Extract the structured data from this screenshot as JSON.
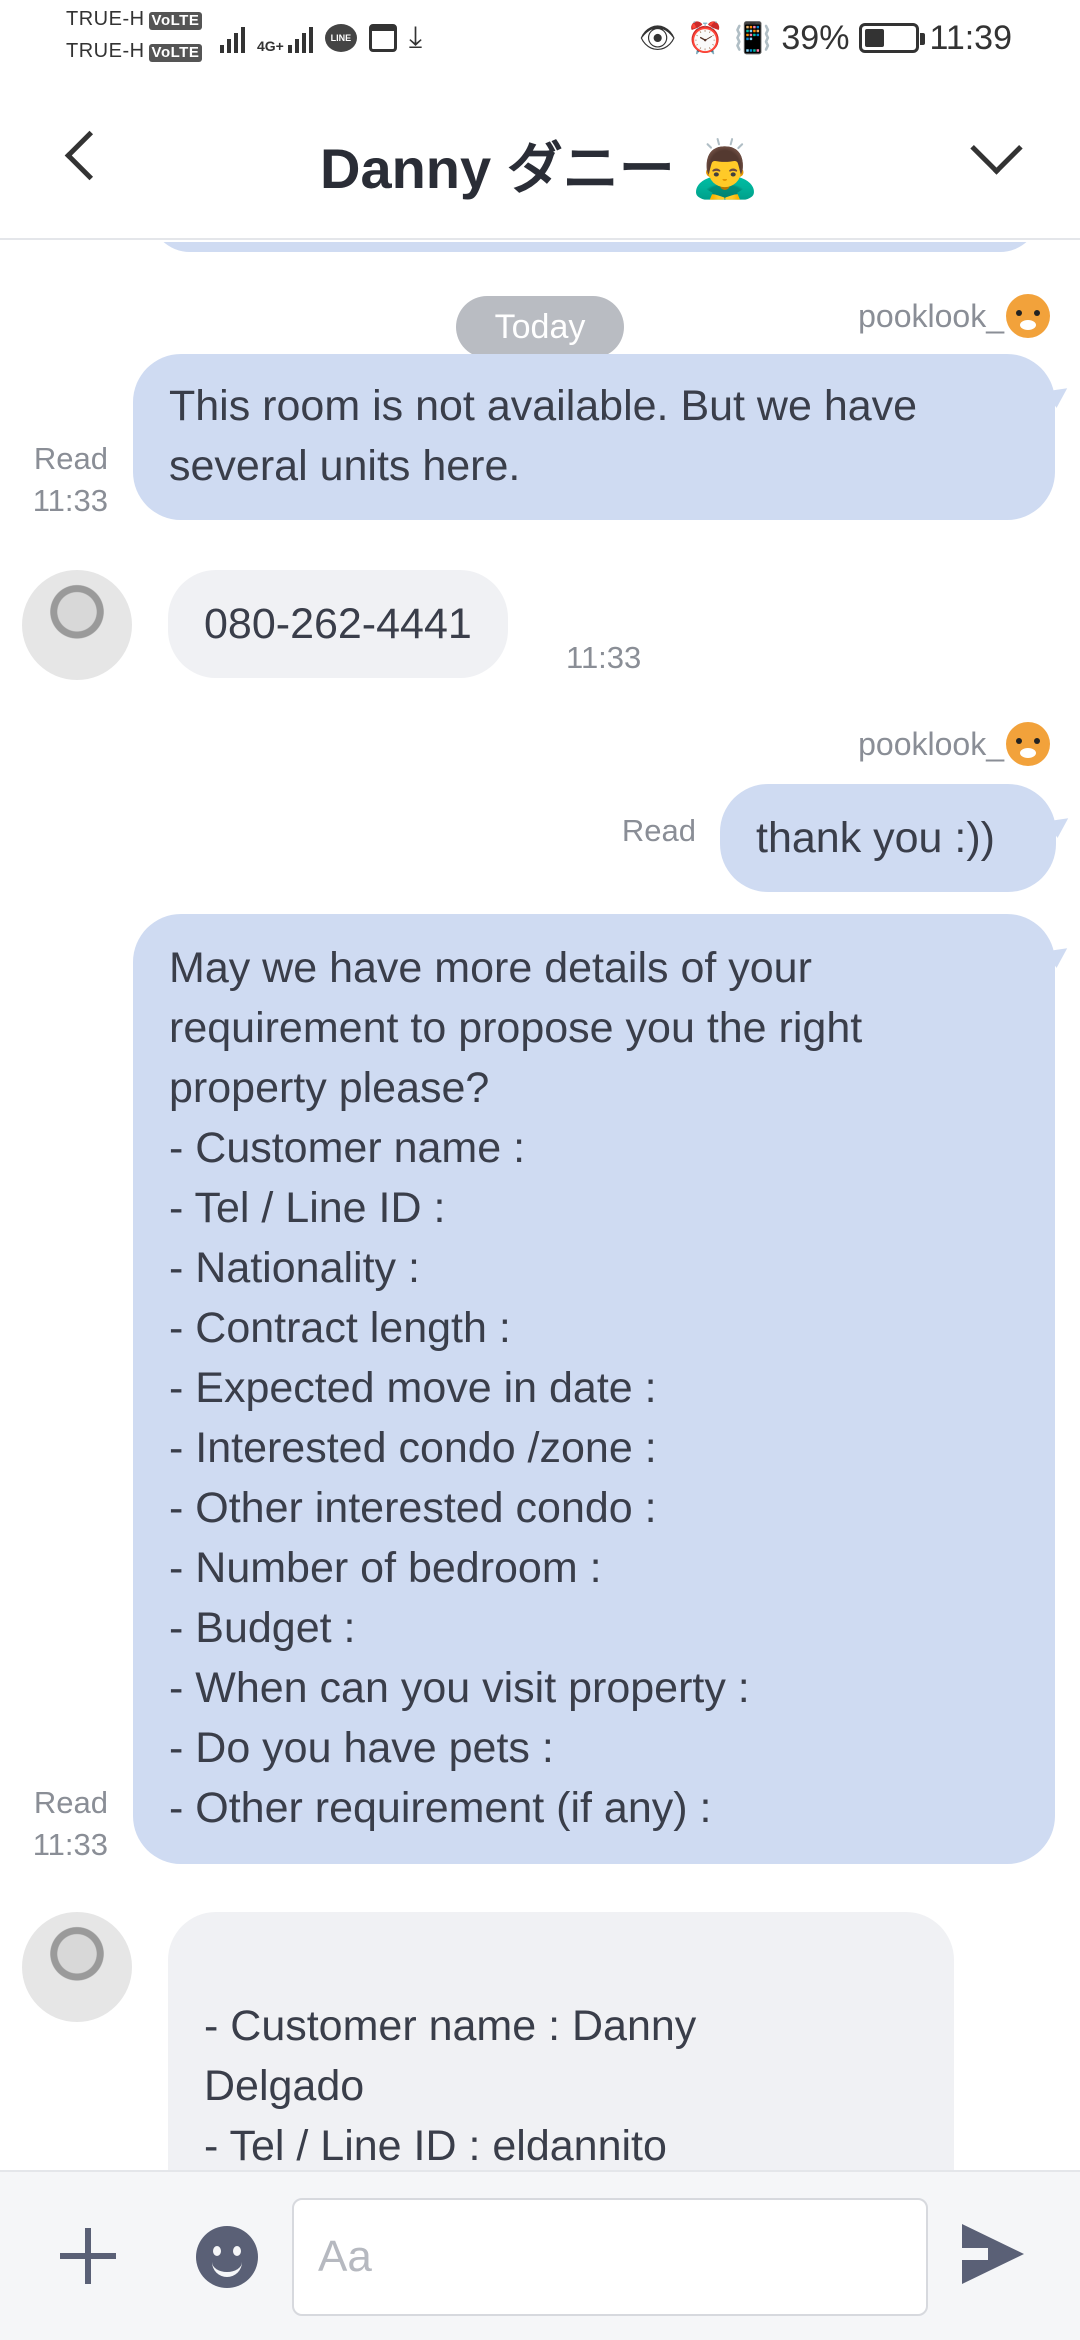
{
  "status_bar": {
    "carrier_1": "TRUE-H",
    "carrier_2": "TRUE-H",
    "volte": "VoLTE",
    "network": "4G+",
    "line_badge": "LINE",
    "battery": "39%",
    "battery_level": 0.39,
    "time": "11:39"
  },
  "header": {
    "title": "Danny ダニー 🙇‍♂️"
  },
  "chat": {
    "date_chip": "Today",
    "messages": [
      {
        "sender": "pooklook_",
        "text": "This room is not available.  But we have several units here.",
        "read": "Read",
        "time": "11:33"
      },
      {
        "text": "080-262-4441",
        "time": "11:33"
      },
      {
        "sender": "pooklook_",
        "text": "thank you :))",
        "read": "Read"
      },
      {
        "text": "May we have more details of your\nrequirement to propose you the right\nproperty please?\n- Customer name :\n- Tel / Line ID :\n- Nationality :\n- Contract length :\n- Expected move in date :\n- Interested condo /zone :\n- Other interested condo :\n- Number of bedroom  :\n- Budget :\n- When can you visit property :\n- Do you have pets :\n- Other requirement (if any) :",
        "read": "Read",
        "time": "11:33"
      },
      {
        "text": "- Customer name : Danny\nDelgado\n- Tel / Line ID : eldannito"
      }
    ]
  },
  "input": {
    "placeholder": "Aa"
  }
}
